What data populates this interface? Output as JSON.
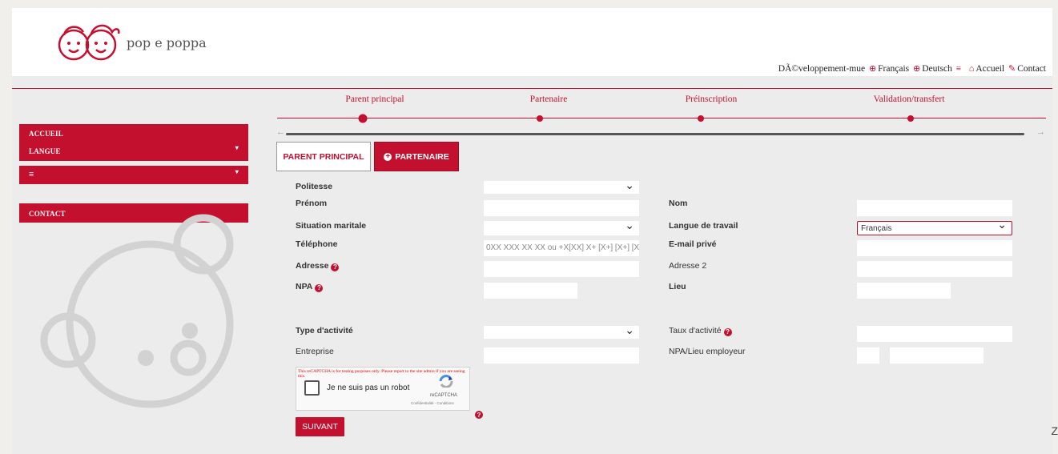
{
  "brand": {
    "name": "pop e poppa"
  },
  "topnav": {
    "dev": "DÃ©veloppement-mue",
    "francais": "Français",
    "deutsch": "Deutsch",
    "accueil": "Accueil",
    "contact": "Contact"
  },
  "sidebar": {
    "accueil": "ACCUEIL",
    "langue": "LANGUE",
    "menu": "≡",
    "contact": "CONTACT"
  },
  "steps": [
    {
      "label": "Parent principal",
      "state": "current"
    },
    {
      "label": "Partenaire",
      "state": "pending"
    },
    {
      "label": "Préinscription",
      "state": "pending"
    },
    {
      "label": "Validation/transfert",
      "state": "pending"
    }
  ],
  "tabs": {
    "parent": "PARENT PRINCIPAL",
    "partenaire": "PARTENAIRE"
  },
  "form": {
    "politesse": "Politesse",
    "prenom": "Prénom",
    "nom": "Nom",
    "situation": "Situation maritale",
    "langue_travail": "Langue de travail",
    "langue_travail_value": "Français",
    "telephone": "Téléphone",
    "telephone_placeholder": "0XX XXX XX XX ou +X[XX] X+ [X+] [X+] [X+]",
    "email": "E-mail privé",
    "adresse": "Adresse",
    "adresse2": "Adresse 2",
    "npa": "NPA",
    "lieu": "Lieu",
    "type_activite": "Type d'activité",
    "taux": "Taux d'activité",
    "entreprise": "Entreprise",
    "npa_lieu_employeur": "NPA/Lieu employeur"
  },
  "captcha": {
    "warning": "This reCAPTCHA is for testing purposes only. Please report to the site admin if you are seeing this.",
    "label": "Je ne suis pas un robot",
    "brand": "reCAPTCHA",
    "links": "Confidentialité - Conditions"
  },
  "submit": "SUIVANT",
  "colors": {
    "accent": "#c4102f",
    "background": "#ececec"
  },
  "icons": [
    "globe-icon",
    "menu-icon",
    "home-icon",
    "contact-icon",
    "help-icon",
    "plus-circle-icon",
    "bear-logo-icon"
  ]
}
